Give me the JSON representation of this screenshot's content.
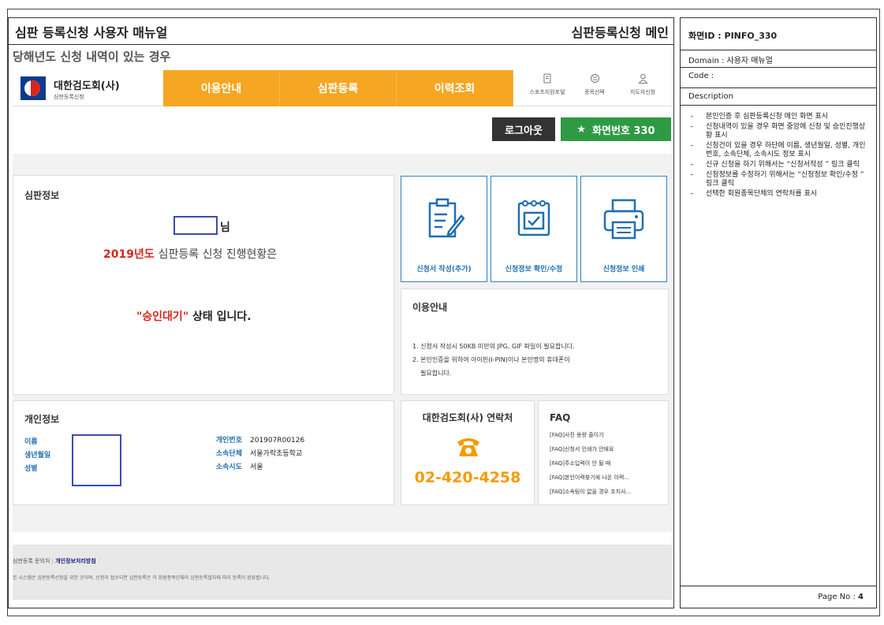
{
  "doc": {
    "title": "심판 등록신청 사용자 매뉴얼",
    "title_right": "심판등록신청 메인",
    "subtitle": "당해년도 신청 내역이 있는 경우"
  },
  "site": {
    "logo_name": "대한검도회(사)",
    "logo_sub": "심판등록신청",
    "menu": [
      "이용안내",
      "심판등록",
      "이력조회"
    ],
    "util": [
      {
        "label": "스포츠지원포털",
        "icon": "document-icon"
      },
      {
        "label": "종목선택",
        "icon": "smile-icon"
      },
      {
        "label": "지도자신청",
        "icon": "user-icon"
      }
    ],
    "logout": "로그아웃",
    "screen_star": "★",
    "screen_no": "화면번호 330"
  },
  "judge_info": {
    "title": "심판정보",
    "name_suffix": "님",
    "year": "2019년도",
    "status_text": "심판등록 신청 진행현황은",
    "status_quote": "\"승인대기\"",
    "status_tail": " 상태 입니다."
  },
  "cards": [
    {
      "label": "신청서 작성(추가)",
      "icon": "clipboard-pen-icon"
    },
    {
      "label": "신청정보 확인/수정",
      "icon": "notebook-check-icon"
    },
    {
      "label": "신청정보 인쇄",
      "icon": "printer-icon"
    }
  ],
  "guide": {
    "title": "이용안내",
    "lines": [
      "1. 신청서 작성시 50KB 미만의 JPG, GIF 파일이 필요합니다.",
      "2. 본인인증을 위하여 아이핀(I-PIN)이나 본인명의 휴대폰이",
      "필요합니다."
    ]
  },
  "personal": {
    "title": "개인정보",
    "labels_left": [
      "이름",
      "생년월일",
      "성별"
    ],
    "labels_right": [
      "개인번호",
      "소속단체",
      "소속시도"
    ],
    "values_right": [
      "201907R00126",
      "서울가락초등학교",
      "서울"
    ]
  },
  "contact": {
    "title": "대한검도회(사) 연락처",
    "phone": "02-420-4258"
  },
  "faq": {
    "title": "FAQ",
    "items": [
      "[FAQ]사진 용량 줄이기",
      "[FAQ]신청서 인쇄가 안돼요",
      "[FAQ]주소입력이 안 될 때",
      "[FAQ]본인이력찾기에 나온 이력...",
      "[FAQ]소속팀이 없을 경우 조치사..."
    ]
  },
  "footer": {
    "inquiry": "심판등록 문의처",
    "privacy": "개인정보처리방침",
    "notice": "본 시스템은 심판등록신청을 위한 곳이며, 신청이 접수되면 심판등록은 각 회원종목단체의 심판등록절차에 따라 등록이 완료됩니다."
  },
  "meta": {
    "screen_id": "화면ID : PINFO_330",
    "domain": "Domain : 사용자 매뉴얼",
    "code": "Code :",
    "description_label": "Description",
    "descriptions": [
      "본인인증 후 심판등록신청 메인 화면 표시",
      "신청내역이 있을 경우 화면 중앙에 신청 및 승인진행상황 표시",
      "신청건이 있을 경우 하단에 이름, 생년월일, 성별, 개인번호, 소속단체, 소속시도 정보 표시",
      "신규 신청을 하기 위해서는 “신청서작성 ” 링크 클릭",
      "신청정보를 수정하기 위해서는 “신청정보 확인/수정 ” 링크 클릭",
      "선택한 회원종목단체의 연락처를 표시"
    ],
    "page_label": "Page No :",
    "page_no": "4"
  },
  "colors": {
    "menu_orange": "#f5a623",
    "accent_blue": "#1f6fb2",
    "highlight_red": "#d9261c",
    "contact_orange": "#f59b00",
    "green": "#2f9a44"
  }
}
